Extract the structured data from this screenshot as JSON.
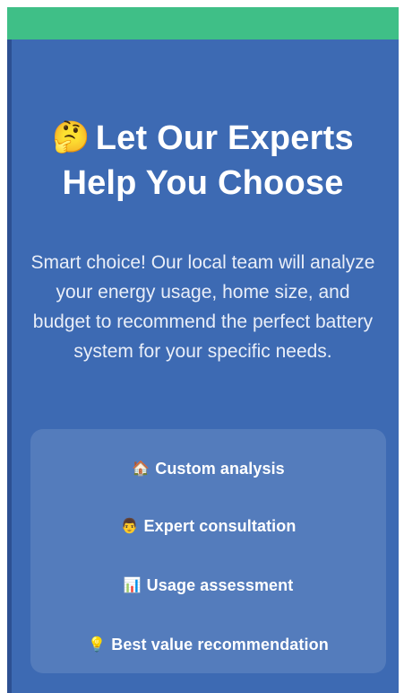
{
  "header": {
    "title_emoji": "🤔",
    "title_line1": "Let Our Experts",
    "title_line2": "Help You Choose"
  },
  "description": "Smart choice! Our local team will analyze your energy usage, home size, and budget to recommend the perfect battery system for your specific needs.",
  "benefits": [
    {
      "icon": "🏠",
      "label": "Custom analysis"
    },
    {
      "icon": "👨",
      "label": "Expert consultation"
    },
    {
      "icon": "📊",
      "label": "Usage assessment"
    },
    {
      "icon": "💡",
      "label": "Best value recommendation"
    }
  ],
  "colors": {
    "accent_bar": "#3fbf87",
    "background": "#3d6ab3",
    "card": "rgba(255,255,255,0.12)"
  }
}
